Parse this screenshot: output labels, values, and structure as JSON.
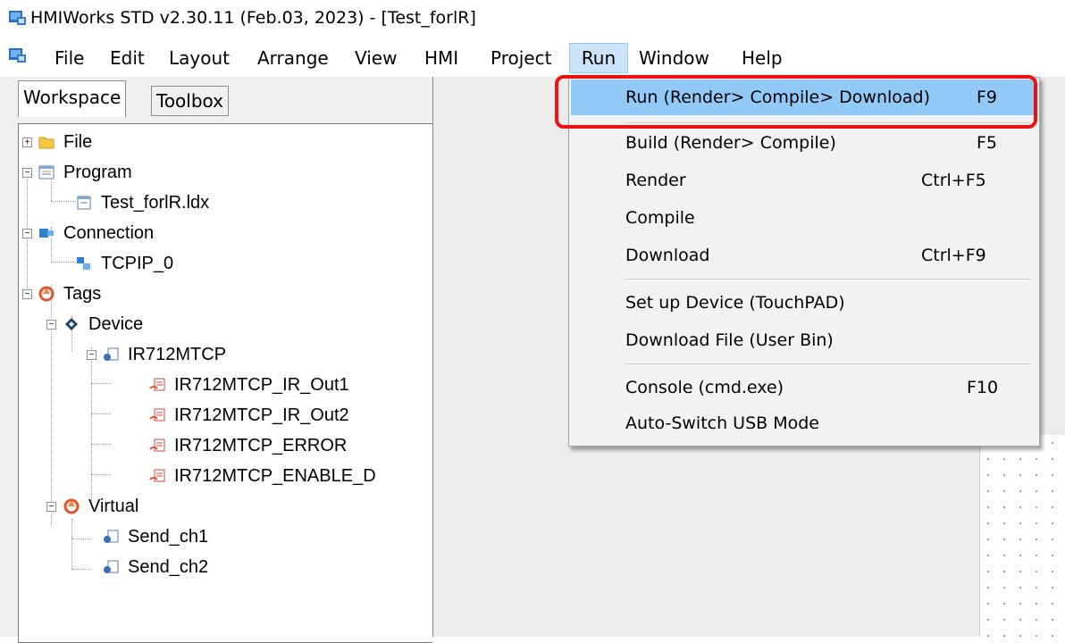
{
  "window": {
    "title": "HMIWorks STD v2.30.11 (Feb.03, 2023) - [Test_forlR]"
  },
  "menubar": {
    "items": [
      "File",
      "Edit",
      "Layout",
      "Arrange",
      "View",
      "HMI",
      "Project",
      "Run",
      "Window",
      "Help"
    ],
    "active": "Run"
  },
  "panel": {
    "tabs": [
      "Workspace",
      "Toolbox"
    ],
    "active_tab": "Workspace"
  },
  "tree": {
    "file": "File",
    "program": "Program",
    "program_file": "Test_forlR.ldx",
    "connection": "Connection",
    "tcpip": "TCPIP_0",
    "tags": "Tags",
    "device": "Device",
    "ir712": "IR712MTCP",
    "ir_out1": "IR712MTCP_IR_Out1",
    "ir_out2": "IR712MTCP_IR_Out2",
    "ir_error": "IR712MTCP_ERROR",
    "ir_enable": "IR712MTCP_ENABLE_D",
    "virtual": "Virtual",
    "send1": "Send_ch1",
    "send2": "Send_ch2"
  },
  "run_menu": {
    "items": [
      {
        "label": "Run (Render> Compile> Download)",
        "shortcut": "F9",
        "highlighted": true
      },
      {
        "label": "Build (Render> Compile)",
        "shortcut": "F5"
      },
      {
        "label": "Render",
        "shortcut": "Ctrl+F5"
      },
      {
        "label": "Compile",
        "shortcut": ""
      },
      {
        "label": "Download",
        "shortcut": "Ctrl+F9"
      },
      {
        "label": "Set up Device (TouchPAD)",
        "shortcut": ""
      },
      {
        "label": "Download File (User Bin)",
        "shortcut": ""
      },
      {
        "label": "Console (cmd.exe)",
        "shortcut": "F10"
      },
      {
        "label": "Auto-Switch USB Mode",
        "shortcut": ""
      }
    ]
  },
  "colors": {
    "highlight": "#91c9f7",
    "callout": "#ee1111",
    "menu_active": "#cce4f7"
  }
}
